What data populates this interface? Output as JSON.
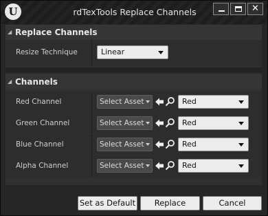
{
  "window": {
    "logo_text": "U",
    "title": "rdTexTools Replace Channels",
    "minimize_icon": "minimize-icon",
    "maximize_icon": "maximize-icon",
    "close_icon": "close-icon"
  },
  "sections": {
    "replace": {
      "title": "Replace Channels",
      "resize_label": "Resize Technique",
      "resize_value": "Linear"
    },
    "channels": {
      "title": "Channels",
      "rows": [
        {
          "label": "Red Channel",
          "asset": "Select Asset",
          "channel": "Red"
        },
        {
          "label": "Green Channel",
          "asset": "Select Asset",
          "channel": "Red"
        },
        {
          "label": "Blue Channel",
          "asset": "Select Asset",
          "channel": "Red"
        },
        {
          "label": "Alpha Channel",
          "asset": "Select Asset",
          "channel": "Red"
        }
      ]
    }
  },
  "footer": {
    "default_label": "Set as Default",
    "replace_label": "Replace",
    "cancel_label": "Cancel"
  }
}
